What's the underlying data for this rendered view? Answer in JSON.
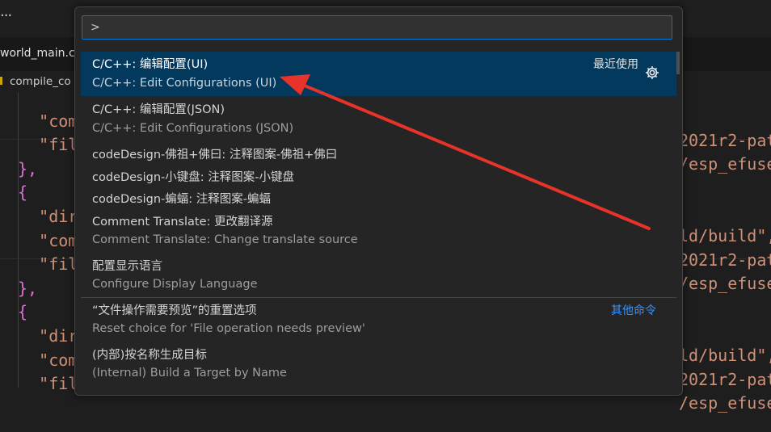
{
  "window": {
    "menu_dots": "...",
    "tab_title": "world_main.c",
    "breadcrumb": "compile_co"
  },
  "editor": {
    "rows": [
      {
        "left": "    \"com",
        "right": "2021r2-pat"
      },
      {
        "left": "    \"fil",
        "right": "/esp_efuse"
      },
      {
        "left": "},",
        "right": ""
      },
      {
        "left": "{",
        "right": ""
      },
      {
        "left": "    \"dir",
        "right": "ld/build\","
      },
      {
        "left": "    \"com",
        "right": "2021r2-pat"
      },
      {
        "left": "    \"fil",
        "right": "/esp_efuse"
      },
      {
        "left": "},",
        "right": ""
      },
      {
        "left": "{",
        "right": ""
      },
      {
        "left": "    \"dir",
        "right": "ld/build\","
      },
      {
        "left": "    \"com",
        "right": "2021r2-pat"
      },
      {
        "left": "    \"fil",
        "right": "/esp_efuse"
      }
    ]
  },
  "quick_pick": {
    "input_value": ">",
    "group_label": "最近使用",
    "other_commands_label": "其他命令",
    "gear_icon": "gear-icon",
    "items": [
      {
        "label": "C/C++: 编辑配置(UI)",
        "desc": "C/C++: Edit Configurations (UI)"
      },
      {
        "label": "C/C++: 编辑配置(JSON)",
        "desc": "C/C++: Edit Configurations (JSON)"
      },
      {
        "label": "codeDesign-佛祖+佛曰: 注释图案-佛祖+佛曰",
        "desc": ""
      },
      {
        "label": "codeDesign-小键盘: 注释图案-小键盘",
        "desc": ""
      },
      {
        "label": "codeDesign-蝙蝠: 注释图案-蝙蝠",
        "desc": ""
      },
      {
        "label": "Comment Translate: 更改翻译源",
        "desc": "Comment Translate: Change translate source"
      },
      {
        "label": "配置显示语言",
        "desc": "Configure Display Language"
      },
      {
        "label": "“文件操作需要预览”的重置选项",
        "desc": "Reset choice for 'File operation needs preview'"
      },
      {
        "label": "(内部)按名称生成目标",
        "desc": "(Internal) Build a Target by Name"
      }
    ]
  },
  "colors": {
    "accent": "#0078d4",
    "selection": "#04395e",
    "link": "#3794ff",
    "annotation_arrow": "#e8332a"
  }
}
